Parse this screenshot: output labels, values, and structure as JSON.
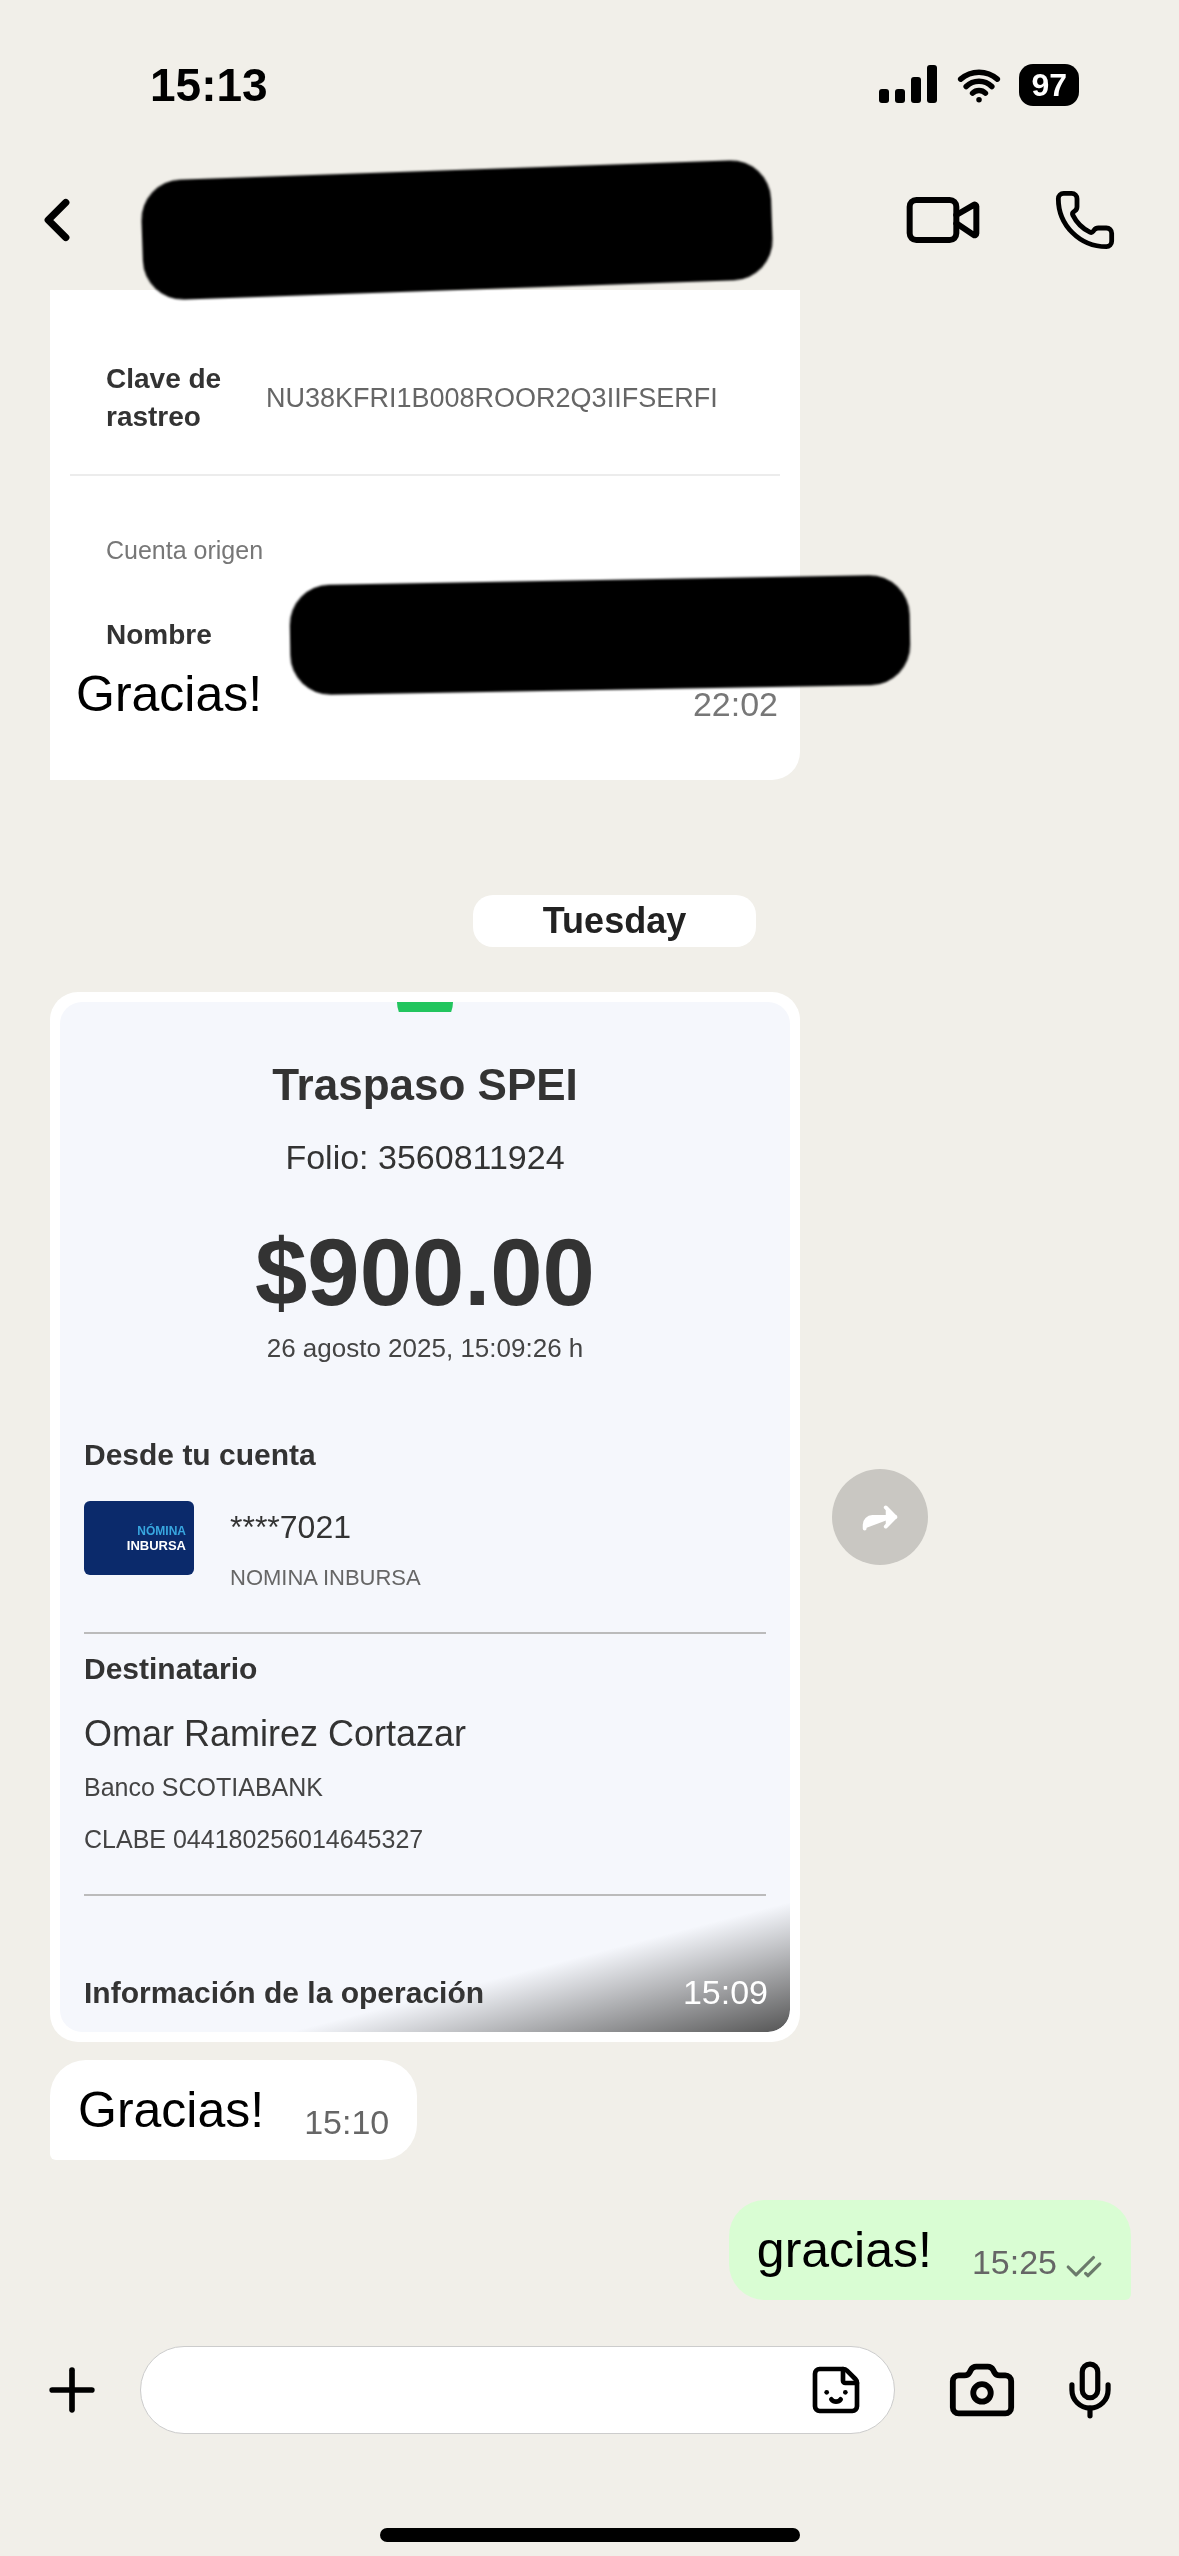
{
  "status_bar": {
    "time": "15:13",
    "battery": "97"
  },
  "messages": [
    {
      "kind": "snippet",
      "row_label": "Clave de rastreo",
      "row_value": "NU38KFRI1B008ROOR2Q3IIFSERFI",
      "section": "Cuenta origen",
      "name_label": "Nombre",
      "text": "Gracias!",
      "time": "22:02"
    },
    {
      "kind": "day",
      "text": "Tuesday"
    },
    {
      "kind": "receipt",
      "title": "Traspaso SPEI",
      "folio": "Folio: 3560811924",
      "amount": "$900.00",
      "date": "26 agosto 2025, 15:09:26 h",
      "from_heading": "Desde tu cuenta",
      "logo_top": "NÓMINA",
      "logo_bottom": "INBURSA",
      "account": "****7021",
      "account_name": "NOMINA INBURSA",
      "to_heading": "Destinatario",
      "recipient": "Omar Ramirez Cortazar",
      "bank": "Banco SCOTIABANK",
      "clabe": "CLABE 044180256014645327",
      "info_heading": "Información de la operación",
      "time": "15:09"
    },
    {
      "kind": "text",
      "outgoing": false,
      "text": "Gracias!",
      "time": "15:10"
    },
    {
      "kind": "text",
      "outgoing": true,
      "text": "gracias!",
      "time": "15:25",
      "read": false
    }
  ]
}
